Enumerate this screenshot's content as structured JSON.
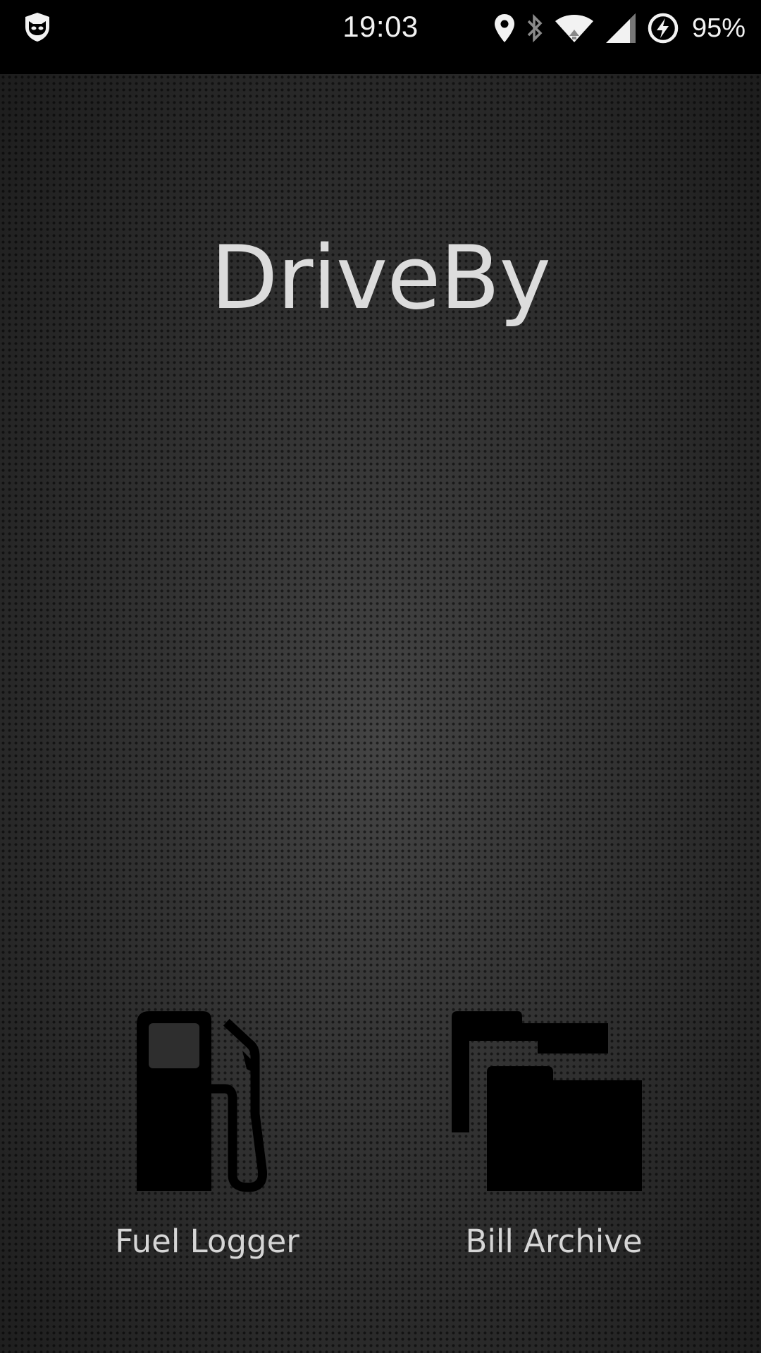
{
  "status_bar": {
    "time": "19:03",
    "battery_percent": "95%",
    "icons": [
      "incognito-icon",
      "location-icon",
      "bluetooth-icon",
      "wifi-icon",
      "signal-icon",
      "battery-charging-icon"
    ]
  },
  "app": {
    "title": "DriveBy"
  },
  "menu": {
    "items": [
      {
        "label": "Fuel Logger",
        "icon": "fuel-pump-icon"
      },
      {
        "label": "Bill Archive",
        "icon": "folders-icon"
      }
    ]
  },
  "colors": {
    "background": "#2f2f2f",
    "status_bar": "#000000",
    "text": "#dcdcdc",
    "icon": "#000000"
  }
}
